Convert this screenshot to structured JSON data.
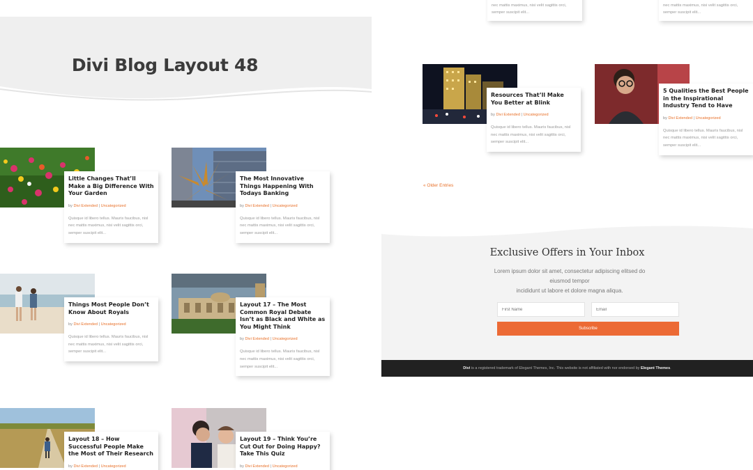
{
  "hero": {
    "title": "Divi Blog Layout 48"
  },
  "posts": [
    {
      "title": "Little Changes That’ll Make a Big Difference With Your Garden",
      "author": "Divi Extended",
      "category": "Uncategorized",
      "excerpt": "Quisque id libero tellus. Mauris faucibus, nisl nec mattis maximus, nisi velit sagittis orci, semper suscipit elit...",
      "image": "flowers"
    },
    {
      "title": "The Most Innovative Things Happening With Todays Banking",
      "author": "Divi Extended",
      "category": "Uncategorized",
      "excerpt": "Quisque id libero tellus. Mauris faucibus, nisl nec mattis maximus, nisi velit sagittis orci, semper suscipit elit...",
      "image": "sculpture"
    },
    {
      "title": "Things Most People Don’t Know About Royals",
      "author": "Divi Extended",
      "category": "Uncategorized",
      "excerpt": "Quisque id libero tellus. Mauris faucibus, nisl nec mattis maximus, nisi velit sagittis orci, semper suscipit elit...",
      "image": "beach"
    },
    {
      "title": "Layout 17 – The Most Common Royal Debate Isn’t as Black and White as You Might Think",
      "author": "Divi Extended",
      "category": "Uncategorized",
      "excerpt": "Quisque id libero tellus. Mauris faucibus, nisl nec mattis maximus, nisi velit sagittis orci, semper suscipit elit...",
      "image": "palace"
    },
    {
      "title": "Layout 18 – How Successful People Make the Most of Their Research",
      "author": "Divi Extended",
      "category": "Uncategorized",
      "excerpt": "",
      "image": "road"
    },
    {
      "title": "Layout 19 – Think You’re Cut Out for Doing Happy? Take This Quiz",
      "author": "Divi Extended",
      "category": "Uncategorized",
      "excerpt": "",
      "image": "family"
    }
  ],
  "right_posts": [
    {
      "title": "Resources That’ll Make You Better at Blink",
      "author": "Divi Extended",
      "category": "Uncategorized",
      "excerpt": "Quisque id libero tellus. Mauris faucibus, nisl nec mattis maximus, nisi velit sagittis orci, semper suscipit elit...",
      "image": "city"
    },
    {
      "title": "5 Qualities the Best People in the Inspirational Industry Tend to Have",
      "author": "Divi Extended",
      "category": "Uncategorized",
      "excerpt": "Quisque id libero tellus. Mauris faucibus, nisl nec mattis maximus, nisi velit sagittis orci, semper suscipit elit...",
      "image": "man"
    }
  ],
  "top_stubs": [
    "Quisque id libero tellus. Mauris faucibus, nisl nec mattis maximus, nisi velit sagittis orci, semper suscipit elit...",
    "Quisque id libero tellus. Mauris faucibus, nisl nec mattis maximus, nisi velit sagittis orci, semper suscipit elit..."
  ],
  "meta": {
    "by": "by",
    "separator": "|"
  },
  "pagination": {
    "older_entries": "« Older Entries"
  },
  "newsletter": {
    "title": "Exclusive Offers in Your Inbox",
    "text_line1": "Lorem ipsum dolor sit amet, consectetur adipiscing elitsed do eiusmod tempor",
    "text_line2": "incididunt ut labore et dolore magna aliqua.",
    "first_name_placeholder": "First Name",
    "email_placeholder": "Email",
    "subscribe_label": "Subscribe"
  },
  "footer": {
    "brand": "Divi",
    "text": " is a registered trademark of Elegant Themes, Inc. This website is not affiliated with nor endorsed by ",
    "company": "Elegant Themes",
    "end": "."
  },
  "colors": {
    "accent": "#e8712a",
    "button": "#ec6a35",
    "footer_bg": "#212121",
    "hero_bg": "#efefef"
  }
}
